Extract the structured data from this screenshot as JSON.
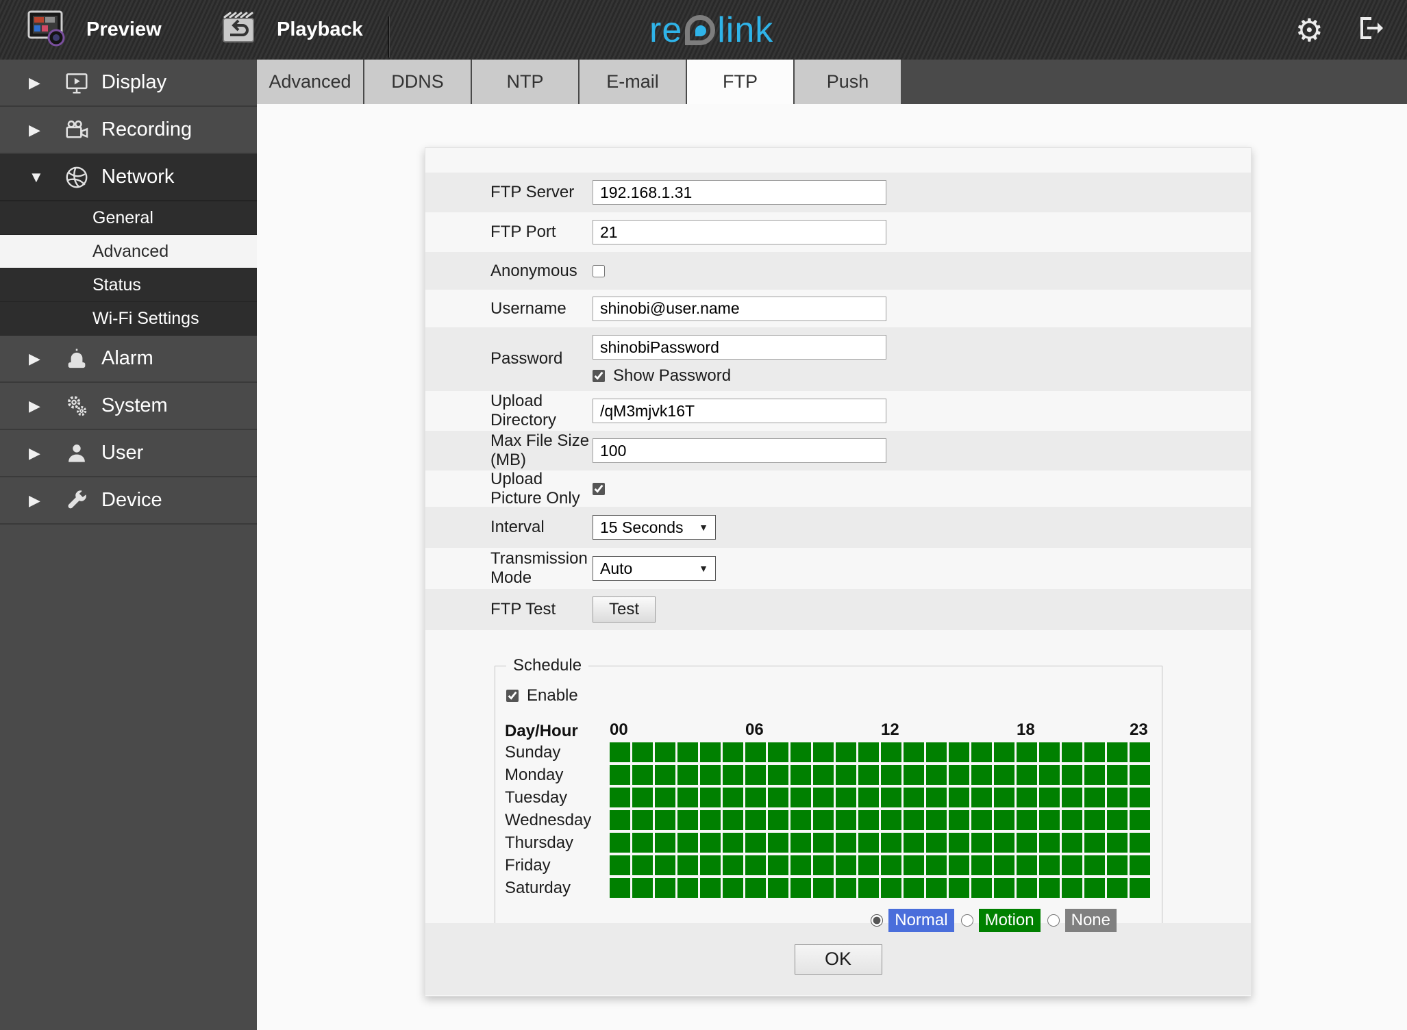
{
  "topbar": {
    "preview_label": "Preview",
    "playback_label": "Playback",
    "logo": {
      "part1": "re",
      "part2": "link"
    },
    "icons": [
      "preview-icon",
      "playback-icon",
      "gear-icon",
      "logout-icon"
    ],
    "gear_glyph": "⚙"
  },
  "sidebar": {
    "items": [
      {
        "label": "Display",
        "icon": "display-icon",
        "caret": "▶"
      },
      {
        "label": "Recording",
        "icon": "recording-icon",
        "caret": "▶"
      },
      {
        "label": "Network",
        "icon": "network-icon",
        "caret": "▼",
        "expanded": true,
        "submenu": [
          {
            "label": "General"
          },
          {
            "label": "Advanced",
            "selected": true
          },
          {
            "label": "Status"
          },
          {
            "label": "Wi-Fi Settings"
          }
        ]
      },
      {
        "label": "Alarm",
        "icon": "alarm-icon",
        "caret": "▶"
      },
      {
        "label": "System",
        "icon": "system-icon",
        "caret": "▶"
      },
      {
        "label": "User",
        "icon": "user-icon",
        "caret": "▶"
      },
      {
        "label": "Device",
        "icon": "device-icon",
        "caret": "▶"
      }
    ]
  },
  "tabs": [
    {
      "label": "Advanced"
    },
    {
      "label": "DDNS"
    },
    {
      "label": "NTP"
    },
    {
      "label": "E-mail"
    },
    {
      "label": "FTP",
      "active": true
    },
    {
      "label": "Push"
    }
  ],
  "form": {
    "rows": [
      {
        "label": "FTP Server",
        "value": "192.168.1.31"
      },
      {
        "label": "FTP Port",
        "value": "21"
      },
      {
        "label": "Anonymous",
        "checked": false
      },
      {
        "label": "Username",
        "value": "shinobi@user.name"
      },
      {
        "label": "Password",
        "value": "shinobiPassword",
        "show_password": {
          "label": "Show Password",
          "checked": true
        }
      },
      {
        "label": "Upload Directory",
        "value": "/qM3mjvk16T"
      },
      {
        "label": "Max File Size (MB)",
        "value": "100"
      },
      {
        "label": "Upload Picture Only",
        "checked": true
      },
      {
        "label": "Interval",
        "value": "15 Seconds",
        "dropdown_arrow": "▼"
      },
      {
        "label": "Transmission Mode",
        "value": "Auto",
        "dropdown_arrow": "▼"
      },
      {
        "label": "FTP Test",
        "button_label": "Test"
      }
    ]
  },
  "schedule": {
    "legend": "Schedule",
    "enable_label": "Enable",
    "enable_checked": true,
    "corner_label": "Day/Hour",
    "hour_labels": [
      {
        "text": "00",
        "col": 0
      },
      {
        "text": "06",
        "col": 6
      },
      {
        "text": "12",
        "col": 12
      },
      {
        "text": "18",
        "col": 18
      },
      {
        "text": "23",
        "col": 23
      }
    ],
    "days": [
      "Sunday",
      "Monday",
      "Tuesday",
      "Wednesday",
      "Thursday",
      "Friday",
      "Saturday"
    ],
    "hours_per_day": 24,
    "fill": "motion",
    "colors": {
      "normal": "#4a6edb",
      "motion": "#008000",
      "none": "#808080"
    },
    "legend_options": [
      {
        "label": "Normal",
        "color": "#4a6edb",
        "selected": true
      },
      {
        "label": "Motion",
        "color": "#008000",
        "selected": false
      },
      {
        "label": "None",
        "color": "#808080",
        "selected": false
      }
    ]
  },
  "ok_label": "OK"
}
